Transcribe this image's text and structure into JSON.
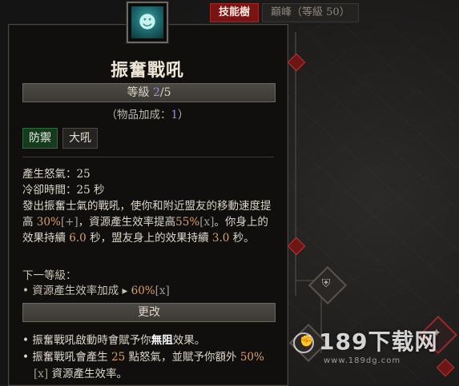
{
  "tabs": [
    {
      "label": "技能樹",
      "active": true
    },
    {
      "label": "巔峰（等級 50）",
      "active": false
    }
  ],
  "skill": {
    "icon": "war-cry-face-icon",
    "name": "振奮戰吼",
    "rank_prefix": "等級 ",
    "rank_current": "2",
    "rank_suffix": "/5",
    "item_bonus_prefix": "（物品加成：",
    "item_bonus_value": "1",
    "item_bonus_suffix": "）",
    "tags": [
      "防禦",
      "大吼"
    ]
  },
  "description": {
    "fury": "產生怒氣：25",
    "cooldown": "冷卻時間：25 秒",
    "text_1": "發出振奮士氣的戰吼，使你和附近盟友的移動速度提高 ",
    "speed_pct": "30%",
    "speed_mark": "[+]",
    "text_2": "，資源產生效率提高",
    "resource_pct": "55%",
    "resource_mark": "[x]",
    "text_3": "。你身上的效果持續 ",
    "self_dur": "6.0",
    "text_4": " 秒，盟友身上的效果持續 ",
    "ally_dur": "3.0",
    "text_5": " 秒。"
  },
  "next_rank": {
    "label": "下一等級：",
    "line_prefix": "• 資源產生效率加成 ▸ ",
    "value": "60%",
    "mark": "[x]"
  },
  "modifier": {
    "title": "更改",
    "bullet1_a": "振奮戰吼啟動時會賦予你",
    "bullet1_b": "無阻",
    "bullet1_c": "效果。",
    "bullet2_a": "振奮戰吼會產生 ",
    "bullet2_num": "25",
    "bullet2_b": " 點怒氣，並賦予你額外 ",
    "bullet2_pct": "50%",
    "bullet2_mark": "[x]",
    "bullet2_c": " 資源產生效率。"
  },
  "watermark": {
    "main": "189下载网",
    "sub": "www.189dg.com"
  },
  "colors": {
    "accent_red": "#7a1414",
    "rank_blue": "#8f8ff0",
    "value_orange": "#d8a06a",
    "tag_green": "#153a1e"
  }
}
